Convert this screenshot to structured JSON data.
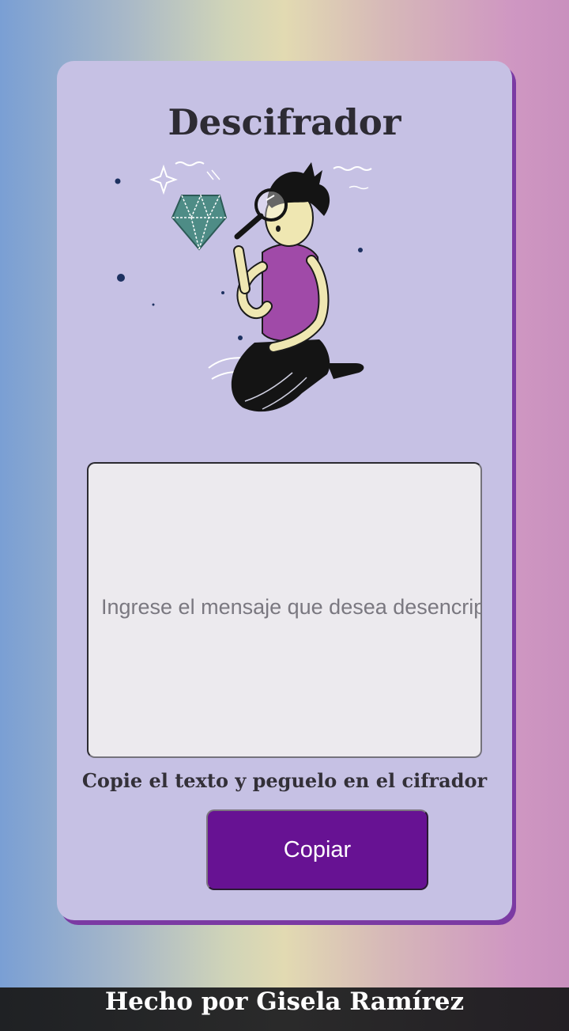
{
  "main": {
    "title": "Descifrador",
    "illustration_icon": "person-with-magnifying-glass-and-diamond-illustration",
    "input": {
      "value": "",
      "placeholder": "Ingrese el mensaje que desea desencriptar"
    },
    "hint": "Copie el texto y peguelo en el cifrador",
    "copy_button_label": "Copiar"
  },
  "footer": {
    "credit": "Hecho por Gisela Ramírez"
  },
  "colors": {
    "card_background": "#c6c1e4",
    "card_shadow": "#7b3aa3",
    "button_background": "#671293",
    "input_background": "#eceaee",
    "footer_background": "#222222"
  }
}
